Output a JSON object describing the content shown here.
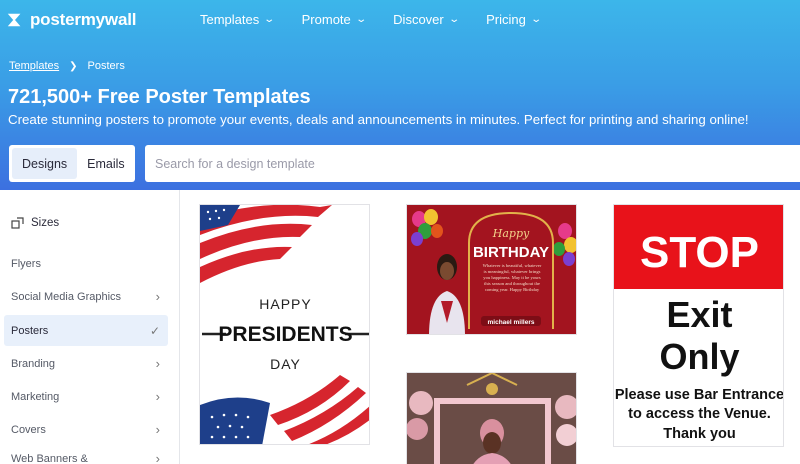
{
  "brand": {
    "name": "postermywall"
  },
  "nav": [
    {
      "label": "Templates"
    },
    {
      "label": "Promote"
    },
    {
      "label": "Discover"
    },
    {
      "label": "Pricing"
    }
  ],
  "breadcrumb": {
    "parent": "Templates",
    "current": "Posters"
  },
  "hero": {
    "title": "721,500+ Free Poster Templates",
    "subtitle": "Create stunning posters to promote your events, deals and announcements in minutes. Perfect for printing and sharing online!"
  },
  "tabs": [
    {
      "label": "Designs",
      "active": true
    },
    {
      "label": "Emails",
      "active": false
    }
  ],
  "search": {
    "placeholder": "Search for a design template",
    "value": ""
  },
  "sidebar": {
    "sizes_label": "Sizes",
    "items": [
      {
        "label": "Flyers",
        "arrow": false
      },
      {
        "label": "Social Media Graphics",
        "arrow": true
      },
      {
        "label": "Posters",
        "arrow": false,
        "active": true
      },
      {
        "label": "Branding",
        "arrow": true
      },
      {
        "label": "Marketing",
        "arrow": true
      },
      {
        "label": "Covers",
        "arrow": true
      },
      {
        "label": "Web Banners &",
        "arrow": true
      }
    ]
  },
  "cards": {
    "presidents": {
      "line1": "HAPPY",
      "line2": "PRESIDENTS",
      "line3": "DAY"
    },
    "birthday": {
      "script": "Happy",
      "title": "BIRTHDAY",
      "message": "Whatever is beautiful, whatever is meaningful, whatever brings you happiness. May it be yours this season and throughout the coming year. Happy Birthday",
      "name": "michael millers"
    },
    "stop": {
      "line1": "STOP",
      "line2": "Exit",
      "line3": "Only",
      "note1": "Please use Bar Entrance",
      "note2": "to access the Venue.",
      "note3": "Thank you"
    }
  },
  "colors": {
    "hero_top": "#3cb6ea",
    "hero_bottom": "#3c70e0",
    "flag_red": "#d6252e",
    "birthday_red": "#a3141f",
    "stop_red": "#e8121a"
  }
}
